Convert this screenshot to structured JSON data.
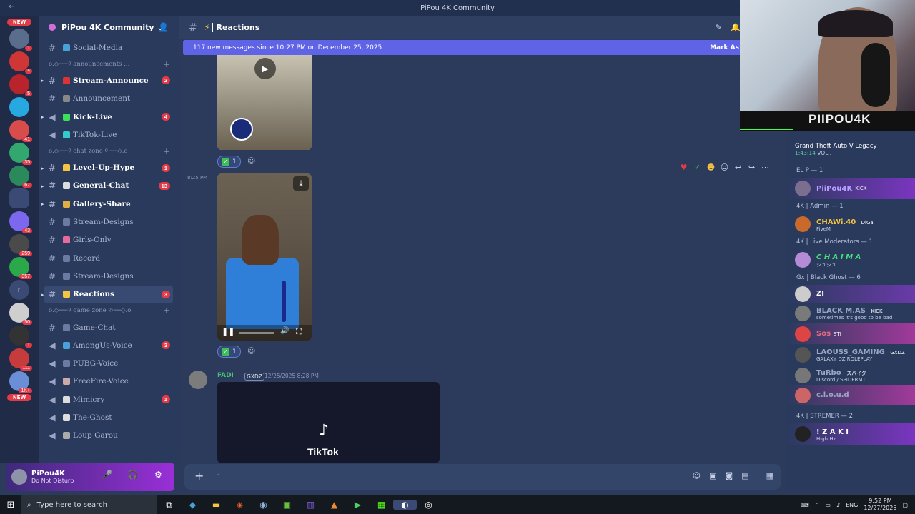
{
  "window": {
    "title": "PiPou 4K Community",
    "back": "←"
  },
  "servers": {
    "new_top": "NEW",
    "new_bottom": "NEW",
    "badges": [
      "1",
      "4",
      "5",
      "1",
      "41",
      "35",
      "67",
      "43",
      "259",
      "357",
      "50",
      "1",
      "111",
      "1K+"
    ],
    "letter": "r",
    "colors": [
      "#5a6d8c",
      "#d03636",
      "#b8232c",
      "#27a8e0",
      "#d84c4c",
      "#32a86e",
      "#2b8a5c",
      "#7b68ee",
      "#4a4a4a",
      "#2ba84a",
      "#cfcfcf",
      "#333333",
      "#c63c3c",
      "#6b8fd6"
    ]
  },
  "channels": {
    "guild_name": "PiPou 4K Community",
    "categories": {
      "announcements": "o.◇──⋅୨ announcements ...",
      "chat_zone": "o.◇──⋅୨ chat zone ୧⋅──◇.o",
      "game_zone": "o.◇──⋅୨ game zone ୧⋅──◇.o"
    },
    "social_media": "Social-Media",
    "stream_announce": "Stream-Announce",
    "stream_announce_count": "2",
    "announcement": "Announcement",
    "kick_live": "Kick-Live",
    "kick_live_count": "4",
    "tiktok_live": "TikTok-Live",
    "level_up": "Level-Up-Hype",
    "level_up_count": "1",
    "general_chat": "General-Chat",
    "general_chat_count": "13",
    "gallery_share": "Gallery-Share",
    "stream_designs": "Stream-Designs",
    "girls_only": "Girls-Only",
    "record": "Record",
    "stream_designs_2": "Stream-Designs",
    "reactions": "Reactions",
    "reactions_count": "3",
    "game_chat": "Game-Chat",
    "amongus_voice": "AmongUs-Voice",
    "amongus_count": "3",
    "pubg_voice": "PUBG-Voice",
    "freefire_voice": "FreeFire-Voice",
    "mimicry": "Mimicry",
    "mimicry_count": "1",
    "the_ghost": "The-Ghost",
    "loup_garou": "Loup Garou"
  },
  "user": {
    "name": "PiPou4K",
    "status": "Do Not Disturb"
  },
  "chat": {
    "channel_title": "Reactions",
    "new_messages": "117 new messages since 10:27 PM on December 25, 2025",
    "mark_as_read": "Mark As",
    "reaction1_count": "1",
    "reaction2_count": "1",
    "time_825": "8:25 PM",
    "author": "FADI",
    "author_tag": "GXDZ",
    "author_time": "12/25/2025 8:28 PM",
    "tiktok_label": "TikTok",
    "composer_placeholder": "-"
  },
  "members": {
    "activity_game": "Grand Theft Auto V Legacy",
    "activity_time": "1:43:14",
    "activity_extra": "VOL..",
    "groups": [
      {
        "label": "EL P — 1",
        "members": [
          {
            "name": "PiiPou4K",
            "tag": "KICK",
            "sub": "",
            "color": "#b8a1ff"
          }
        ]
      },
      {
        "label": "4K | Admin — 1",
        "members": [
          {
            "name": "CHAWi.40",
            "tag": "DiGa",
            "sub": "FiveM",
            "color": "#f5c542"
          }
        ]
      },
      {
        "label": "4K | Live Moderators — 1",
        "members": [
          {
            "name": "C H A I M A",
            "tag": "",
            "sub": "シュシュ",
            "color": "#47e07a"
          }
        ]
      },
      {
        "label": "Gx | Black Ghost — 6",
        "members": [
          {
            "name": "ZI",
            "tag": "",
            "sub": "",
            "color": "#ffffff"
          },
          {
            "name": "BLACK M.AS",
            "tag": "KICK",
            "sub": "sometimes it's good to be bad",
            "color": "#9aa5c4"
          },
          {
            "name": "Sos",
            "tag": "STI",
            "sub": "",
            "color": "#e56b7e"
          },
          {
            "name": "LAOUSS_GAMING",
            "tag": "GXDZ",
            "sub": "GALAXY DZ ROLEPLAY",
            "color": "#9aa5c4"
          },
          {
            "name": "TuRbo",
            "tag": "スパイダ",
            "sub": "Discord / SPIDERMT",
            "color": "#9aa5c4"
          },
          {
            "name": "c.l.o.u.d",
            "tag": "",
            "sub": "",
            "color": "#9aa5c4"
          }
        ]
      },
      {
        "label": "4K | STREMER — 2",
        "members": [
          {
            "name": "! Z A K I",
            "tag": "",
            "sub": "High Hz",
            "color": "#ffffff"
          }
        ]
      }
    ]
  },
  "webcam": {
    "label": "PIIPOU4K"
  },
  "taskbar": {
    "search_placeholder": "Type here to search",
    "lang": "ENG",
    "time": "9:52 PM",
    "date": "12/27/2025"
  }
}
